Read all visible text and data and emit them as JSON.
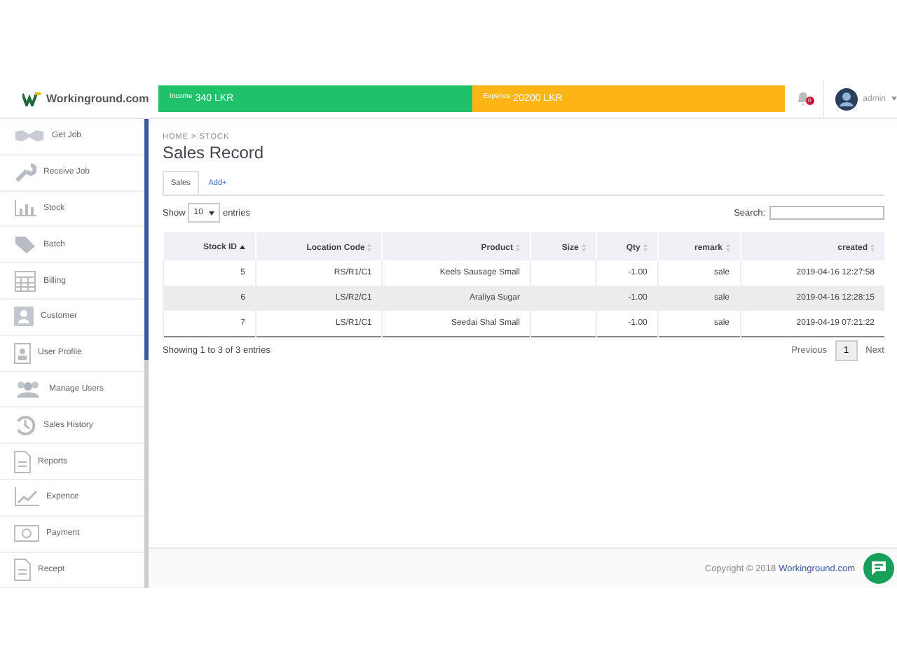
{
  "brand": "Workinground.com",
  "header": {
    "income_label": "Income",
    "income_value": "340 LKR",
    "expense_label": "Expence",
    "expense_value": "20200 LKR",
    "notification_count": "0",
    "user": "admin"
  },
  "sidebar": {
    "items": [
      {
        "label": "Get Job"
      },
      {
        "label": "Receive Job"
      },
      {
        "label": "Stock"
      },
      {
        "label": "Batch"
      },
      {
        "label": "Billing"
      },
      {
        "label": "Customer"
      },
      {
        "label": "User Profile"
      },
      {
        "label": "Manage Users"
      },
      {
        "label": "Sales History"
      },
      {
        "label": "Reports"
      },
      {
        "label": "Expence"
      },
      {
        "label": "Payment"
      },
      {
        "label": "Recept"
      }
    ]
  },
  "breadcrumb": "HOME > STOCK",
  "title": "Sales Record",
  "tabs": [
    {
      "label": "Sales",
      "selected": true
    },
    {
      "label": "Add+",
      "selected": false
    }
  ],
  "length_menu": {
    "show": "Show",
    "value": "10",
    "entries": "entries"
  },
  "search": {
    "label": "Search:"
  },
  "table": {
    "columns": [
      {
        "label": "Stock ID",
        "sorted": true
      },
      {
        "label": "Location Code",
        "sorted": false
      },
      {
        "label": "Product",
        "sorted": false
      },
      {
        "label": "Size",
        "sorted": false
      },
      {
        "label": "Qty",
        "sorted": false
      },
      {
        "label": "remark",
        "sorted": false
      },
      {
        "label": "created",
        "sorted": false
      }
    ],
    "rows": [
      [
        "5",
        "RS/R1/C1",
        "Keels Sausage Small",
        "",
        "-1.00",
        "sale",
        "2019-04-16 12:27:58"
      ],
      [
        "6",
        "LS/R2/C1",
        "Araliya Sugar",
        "",
        "-1.00",
        "sale",
        "2019-04-16 12:28:15"
      ],
      [
        "7",
        "LS/R1/C1",
        "Seedai Shal Small",
        "",
        "-1.00",
        "sale",
        "2019-04-19 07:21:22"
      ]
    ]
  },
  "info": "Showing 1 to 3 of 3 entries",
  "pagination": {
    "previous": "Previous",
    "pages": [
      {
        "label": "1",
        "selected": true
      }
    ],
    "next": "Next"
  },
  "footer": {
    "copyright": "Copyright © 2018",
    "link": "Workinground.com"
  }
}
